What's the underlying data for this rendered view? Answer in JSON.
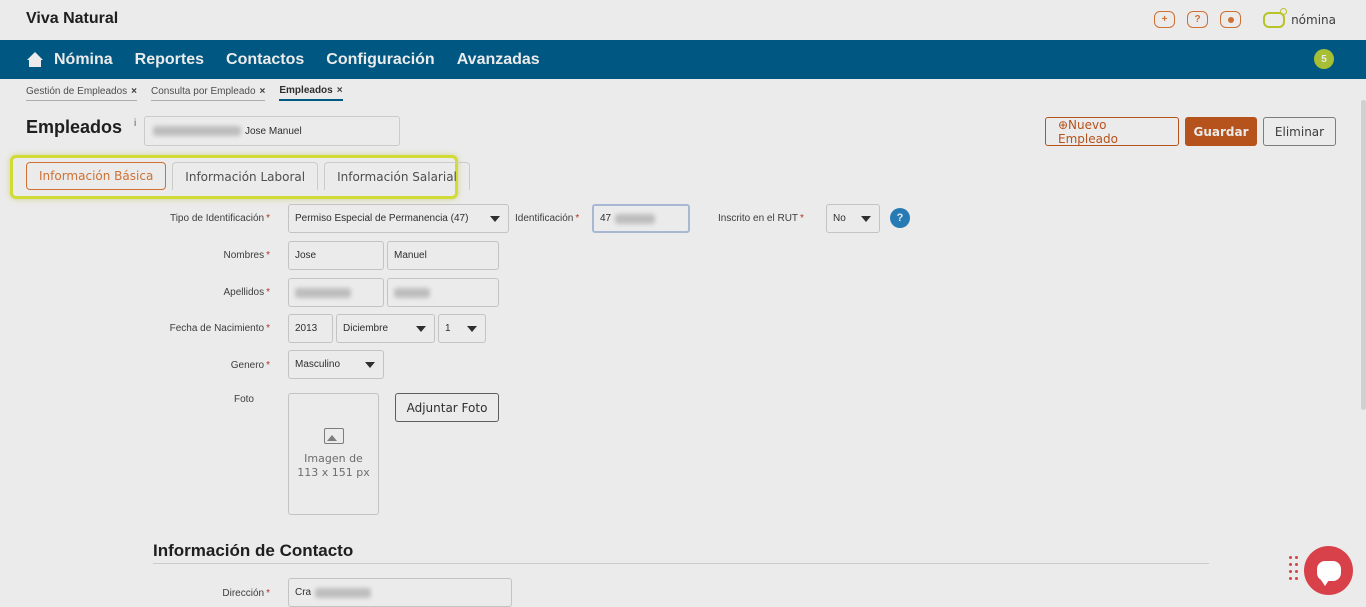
{
  "app": {
    "brand": "Viva Natural",
    "logo_text": "nómina",
    "top_icons": [
      "plus-icon",
      "help-icon",
      "user-icon"
    ],
    "top_icon_glyphs": [
      "+",
      "?",
      ""
    ]
  },
  "nav": {
    "items": [
      "Nómina",
      "Reportes",
      "Contactos",
      "Configuración",
      "Avanzadas"
    ],
    "badge": "5"
  },
  "breadcrumbs": [
    {
      "label": "Gestión de Empleados",
      "close": "×"
    },
    {
      "label": "Consulta por Empleado",
      "close": "×"
    },
    {
      "label": "Empleados",
      "close": "×"
    }
  ],
  "header": {
    "title": "Empleados",
    "info_glyph": "i",
    "employee_name": "Jose Manuel"
  },
  "actions": {
    "new_employee": "⊕Nuevo Empleado",
    "save": "Guardar",
    "delete": "Eliminar"
  },
  "tabs": [
    "Información Básica",
    "Información Laboral",
    "Información Salarial"
  ],
  "form": {
    "tipo_id_label": "Tipo de Identificación",
    "tipo_id_value": "Permiso Especial de Permanencia (47)",
    "identificacion_label": "Identificación",
    "identificacion_value": "47",
    "rut_label": "Inscrito en el RUT",
    "rut_value": "No",
    "help_glyph": "?",
    "nombres_label": "Nombres",
    "nombre1": "Jose",
    "nombre2": "Manuel",
    "apellidos_label": "Apellidos",
    "nacimiento_label": "Fecha de Nacimiento",
    "anio": "2013",
    "mes": "Diciembre",
    "dia": "1",
    "genero_label": "Genero",
    "genero_value": "Masculino",
    "foto_label": "Foto",
    "foto_placeholder_1": "Imagen de",
    "foto_placeholder_2": "113 x 151 px",
    "upload_label": "Adjuntar Foto",
    "required_mark": "*"
  },
  "contact": {
    "section_title": "Información de Contacto",
    "direccion_label": "Dirección",
    "direccion_value": "Cra"
  }
}
